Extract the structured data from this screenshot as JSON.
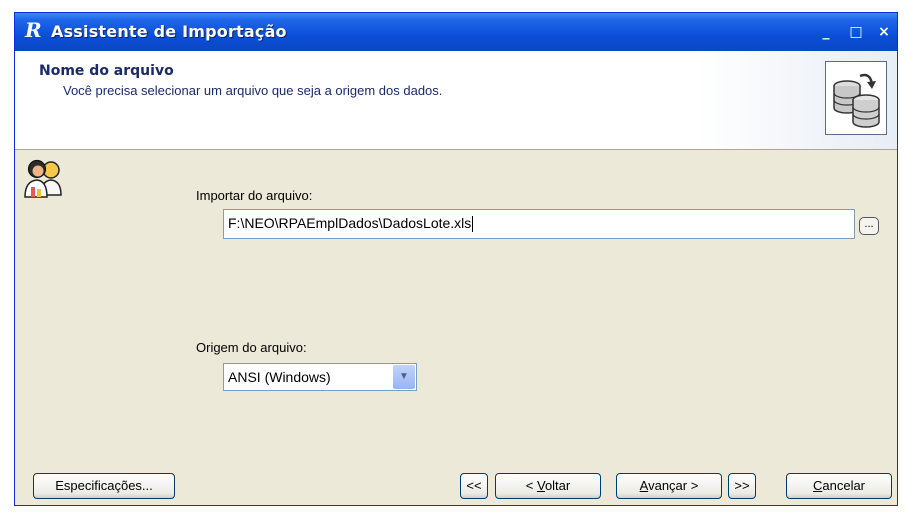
{
  "window": {
    "title": "Assistente de Importação",
    "logo": "R",
    "controls": {
      "minimize": "_",
      "maximize": "□",
      "close": "×"
    }
  },
  "header": {
    "title": "Nome do arquivo",
    "subtitle": "Você precisa selecionar um arquivo que seja a origem dos dados.",
    "icon": "database-transfer-icon"
  },
  "side_icon": "people-icon",
  "import": {
    "label": "Importar do arquivo:",
    "value": "F:\\NEO\\RPAEmplDados\\DadosLote.xls",
    "browse_label": "..."
  },
  "origin": {
    "label": "Origem do arquivo:",
    "selected": "ANSI (Windows)"
  },
  "buttons": {
    "specs": "Especificações...",
    "first": "<<",
    "back_prefix": "< ",
    "back_key": "V",
    "back_rest": "oltar",
    "next_key": "A",
    "next_rest": "vançar >",
    "last": ">>",
    "cancel_key": "C",
    "cancel_rest": "ancelar"
  },
  "colors": {
    "titlebar": "#0a4fd8",
    "dialog_bg": "#ece9d8",
    "header_text": "#1b2a6b"
  }
}
